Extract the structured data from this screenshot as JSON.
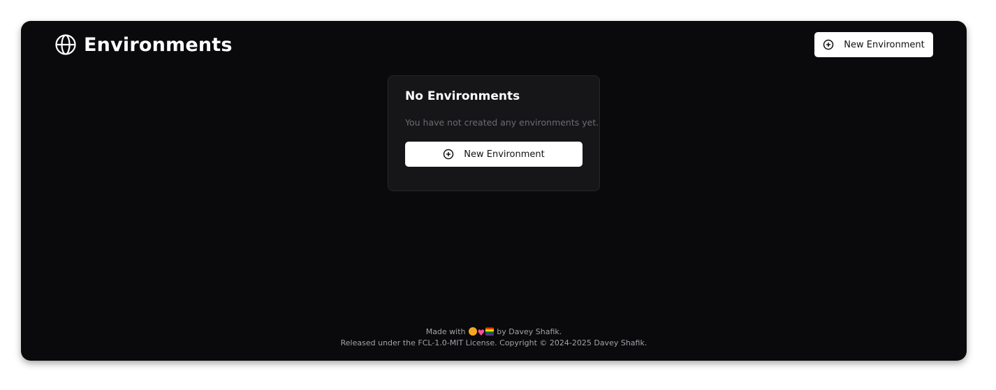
{
  "header": {
    "title": "Environments",
    "icon": "globe-icon",
    "new_button_label": "New Environment"
  },
  "empty_state": {
    "title": "No Environments",
    "description": "You have not created any environments yet.",
    "button_label": "New Environment"
  },
  "footer": {
    "made_with_prefix": "Made with",
    "made_with_suffix": "by Davey Shafik.",
    "license_line": "Released under the FCL-1.0-MIT License. Copyright © 2024-2025 Davey Shafik."
  },
  "colors": {
    "background": "#0a0a0c",
    "card": "#161618",
    "button": "#ffffff",
    "muted_text": "#6b6b72"
  }
}
